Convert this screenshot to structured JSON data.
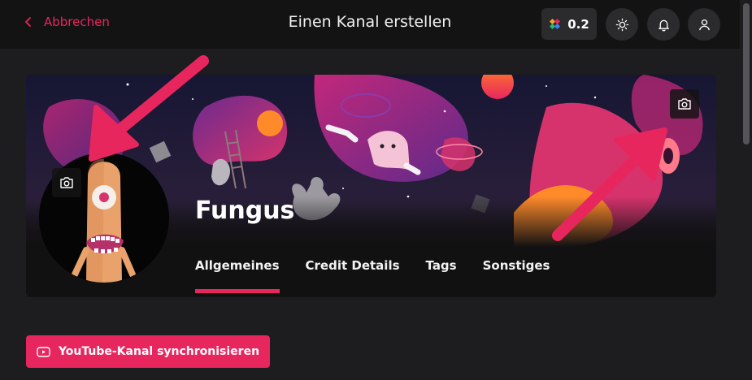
{
  "header": {
    "back_label": "Abbrechen",
    "title": "Einen Kanal erstellen",
    "credits_value": "0.2"
  },
  "channel": {
    "name": "Fungus"
  },
  "tabs": [
    {
      "label": "Allgemeines",
      "active": true
    },
    {
      "label": "Credit Details",
      "active": false
    },
    {
      "label": "Tags",
      "active": false
    },
    {
      "label": "Sonstiges",
      "active": false
    }
  ],
  "actions": {
    "youtube_sync_label": "YouTube-Kanal synchronisieren"
  },
  "colors": {
    "accent": "#e8265e",
    "background": "#1d1c1e",
    "topbar": "#141314"
  },
  "icons": [
    "chevron-left-icon",
    "credits-logo-icon",
    "sun-icon",
    "bell-icon",
    "user-icon",
    "camera-icon",
    "youtube-icon"
  ]
}
